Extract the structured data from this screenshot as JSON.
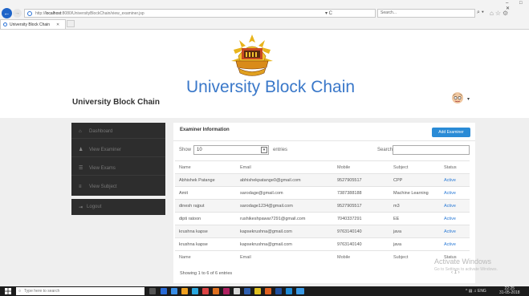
{
  "browser": {
    "url_prefix": "http://",
    "url_host": "localhost",
    "url_rest": ":8080/UniversityBlockChain/view_examiner.jsp",
    "url_actions": "▾ C",
    "search_placeholder": "Search...",
    "search_go": "⌕ ▾",
    "toolbar_icons": "⌂☆⚙",
    "window_controls": "– □ ✕",
    "tab_title": "University Block Chain",
    "tab_close": "✕"
  },
  "header": {
    "site_title": "University Block Chain",
    "brand": "University Block Chain",
    "avatar_caret": "▾"
  },
  "sidebar": {
    "items": [
      {
        "label": "Dashboard",
        "icon": "home-icon",
        "glyph": "⌂"
      },
      {
        "label": "View Examiner",
        "icon": "user-icon",
        "glyph": "♟"
      },
      {
        "label": "View Exams",
        "icon": "file-icon",
        "glyph": "☰"
      },
      {
        "label": "View Subject",
        "icon": "book-icon",
        "glyph": "≡"
      }
    ],
    "logout": {
      "label": "Logout",
      "icon": "logout-icon",
      "glyph": "⇥"
    }
  },
  "panel": {
    "title": "Examiner Information",
    "add_button": "Add Examiner",
    "show_label": "Show",
    "entries_value": "10",
    "entries_label": "entries",
    "search_label": "Search:",
    "search_value": "",
    "info": "Showing 1 to 6 of 6 entries"
  },
  "table": {
    "columns": [
      "Name",
      "Email",
      "Mobile",
      "Subject",
      "Status"
    ],
    "rows": [
      [
        "Abhishek Patange",
        "abhishekpatange0@gmail.com",
        "9527905517",
        "CPP",
        "Active"
      ],
      [
        "Amit",
        "sarodage@gmail.com",
        "7387388188",
        "Machine Learning",
        "Active"
      ],
      [
        "dinesh rajput",
        "sarodage1234@gmail.com",
        "9527905517",
        "m3",
        "Active"
      ],
      [
        "dipti ratoon",
        "rushikeshpawar7291@gmail.com",
        "7040337291",
        "EE",
        "Active"
      ],
      [
        "krushna kapse",
        "kapsekrushna@gmail.com",
        "9763140140",
        "java",
        "Active"
      ],
      [
        "krushna kapse",
        "kapsekrushna@gmail.com",
        "9763140140",
        "java",
        "Active"
      ]
    ]
  },
  "overlay": {
    "watermark": "Activate Windows",
    "watermark_sub": "Go to Settings to activate Windows.",
    "pager": "‹ 1 ›"
  },
  "taskbar": {
    "search_placeholder": "Type here to search",
    "tray": "^ ▤ ♫ ENG",
    "time": "22:25",
    "date": "31-05-2018"
  },
  "colors": {
    "accent": "#2a8bd6",
    "title_blue": "#3a78c9",
    "sidebar_bg": "#2d2d2d",
    "status_active": "#2a7ad6"
  }
}
